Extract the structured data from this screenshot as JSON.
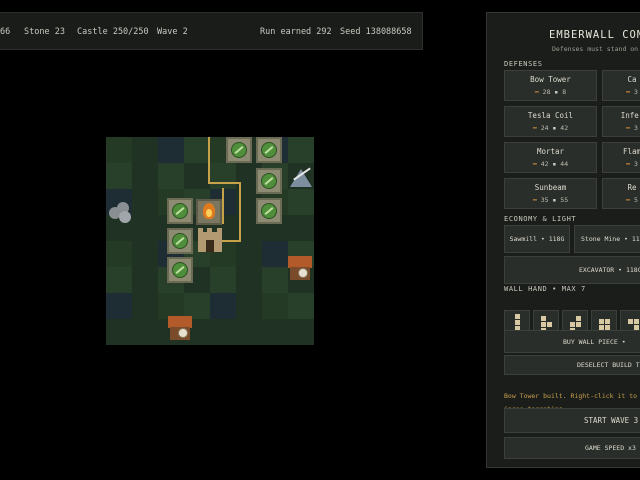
{
  "hud": {
    "first_value": "66",
    "stone": "Stone  23",
    "castle": "Castle 250/250",
    "wave": "Wave  2",
    "run_earned": "Run earned  292",
    "seed": "Seed  138088658"
  },
  "panel": {
    "title": "EMBERWALL COM",
    "subtitle": "Defenses must stand on w",
    "defenses_header": "DEFENSES",
    "defenses": [
      {
        "name": "Bow Tower",
        "stat1": "28",
        "stat2": "8"
      },
      {
        "name": "Ca",
        "stat1": "3",
        "stat2": ""
      },
      {
        "name": "Tesla Coil",
        "stat1": "24",
        "stat2": "42"
      },
      {
        "name": "Infer",
        "stat1": "3",
        "stat2": ""
      },
      {
        "name": "Mortar",
        "stat1": "42",
        "stat2": "44"
      },
      {
        "name": "Flam",
        "stat1": "3",
        "stat2": ""
      },
      {
        "name": "Sunbeam",
        "stat1": "35",
        "stat2": "55"
      },
      {
        "name": "Re",
        "stat1": "5",
        "stat2": ""
      }
    ],
    "economy_header": "ECONOMY & LIGHT",
    "economy": [
      {
        "label": "Sawmill • 118G"
      },
      {
        "label": "Stone Mine • 11"
      },
      {
        "label": "EXCAVATOR • 118G"
      }
    ],
    "wall_hand_header": "WALL HAND  •  MAX 7",
    "buy_wall_piece": "BUY WALL PIECE  •",
    "deselect": "DESELECT BUILD TO",
    "message": "Bow Tower built. Right-click it to inspe targeting.",
    "start_wave": "START WAVE 3",
    "game_speed": "GAME SPEED  x3"
  },
  "colors": {
    "accent": "#c8a24a",
    "panel_bg": "#1b1d1b",
    "grass_dark": "#203224",
    "grass_light": "#28402a"
  }
}
